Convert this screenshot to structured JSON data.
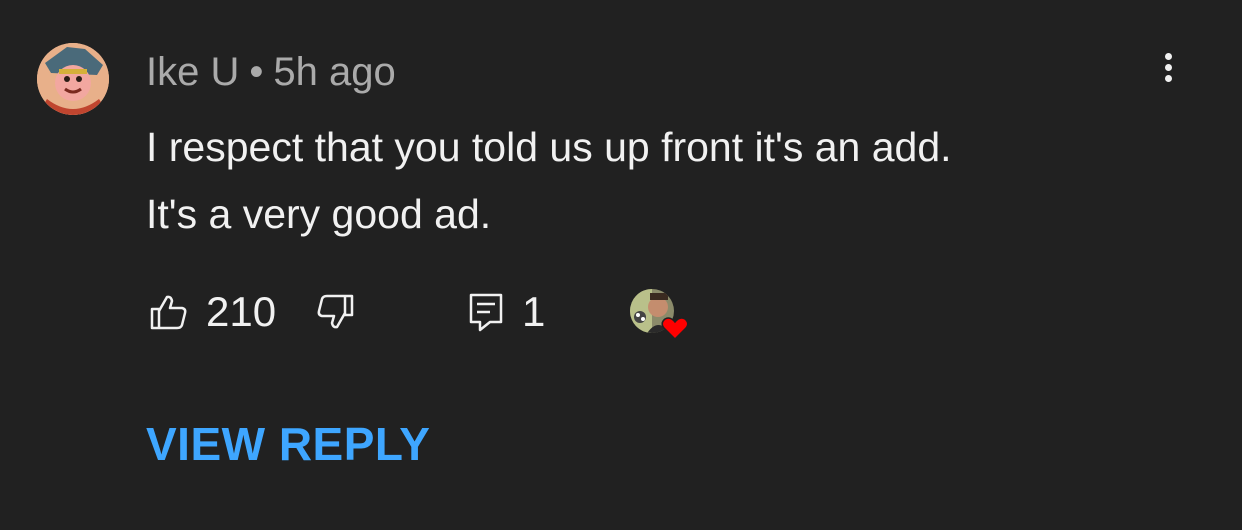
{
  "comment": {
    "author": "Ike U",
    "separator": "•",
    "timestamp": "5h ago",
    "text_lines": [
      "I respect that you told us up front it's an add.",
      "It's a very good ad."
    ],
    "like_count": "210",
    "reply_count": "1",
    "view_reply_label": "VIEW REPLY"
  },
  "icons": {
    "avatar": "user-avatar",
    "more": "more-vertical-icon",
    "like": "thumbs-up-icon",
    "dislike": "thumbs-down-icon",
    "reply": "comment-icon",
    "creator_heart": "creator-heart-badge"
  },
  "colors": {
    "background": "#212121",
    "text": "#f1f1f1",
    "meta": "#aaaaaa",
    "link": "#3ea6ff",
    "heart": "#ff0000"
  }
}
